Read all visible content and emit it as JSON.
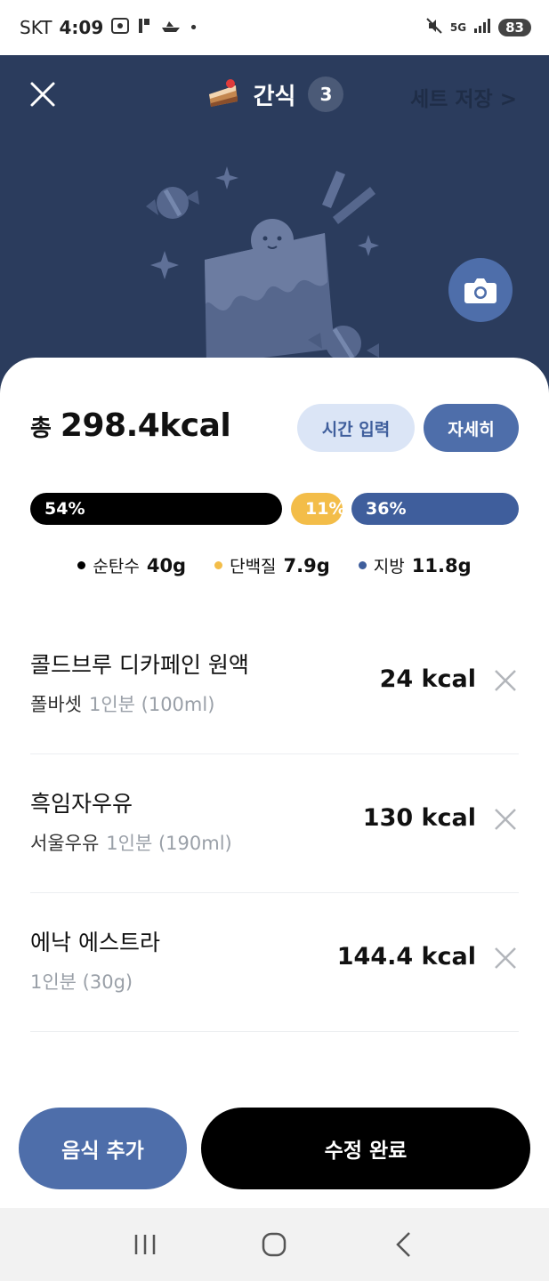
{
  "status_bar": {
    "carrier": "SKT",
    "time": "4:09",
    "network": "5G",
    "battery": "83"
  },
  "header": {
    "title": "간식",
    "count": "3",
    "set_save_label": "세트 저장 >"
  },
  "summary": {
    "total_prefix": "총",
    "total_kcal": "298.4kcal",
    "time_input_label": "시간 입력",
    "detail_label": "자세히"
  },
  "ratios": {
    "carb_label": "54%",
    "protein_label": "11%",
    "fat_label": "36%",
    "carb_pct": 54,
    "protein_pct": 11,
    "fat_pct": 36,
    "carb_color": "#000000",
    "protein_color": "#f3bd49",
    "fat_color": "#3f5e9c"
  },
  "macros": [
    {
      "name": "순탄수",
      "amount": "40g"
    },
    {
      "name": "단백질",
      "amount": "7.9g"
    },
    {
      "name": "지방",
      "amount": "11.8g"
    }
  ],
  "foods": [
    {
      "name": "콜드브루 디카페인 원액",
      "brand": "폴바셋",
      "serving": "1인분 (100ml)",
      "kcal": "24 kcal"
    },
    {
      "name": "흑임자우유",
      "brand": "서울우유",
      "serving": "1인분 (190ml)",
      "kcal": "130 kcal"
    },
    {
      "name": "에낙 에스트라",
      "brand": "",
      "serving": "1인분 (30g)",
      "kcal": "144.4 kcal"
    }
  ],
  "actions": {
    "add_food_label": "음식 추가",
    "done_label": "수정 완료"
  },
  "colors": {
    "header_bg": "#2b3c5d",
    "accent": "#4e6eaa",
    "accent_light": "#dbe5f6"
  }
}
